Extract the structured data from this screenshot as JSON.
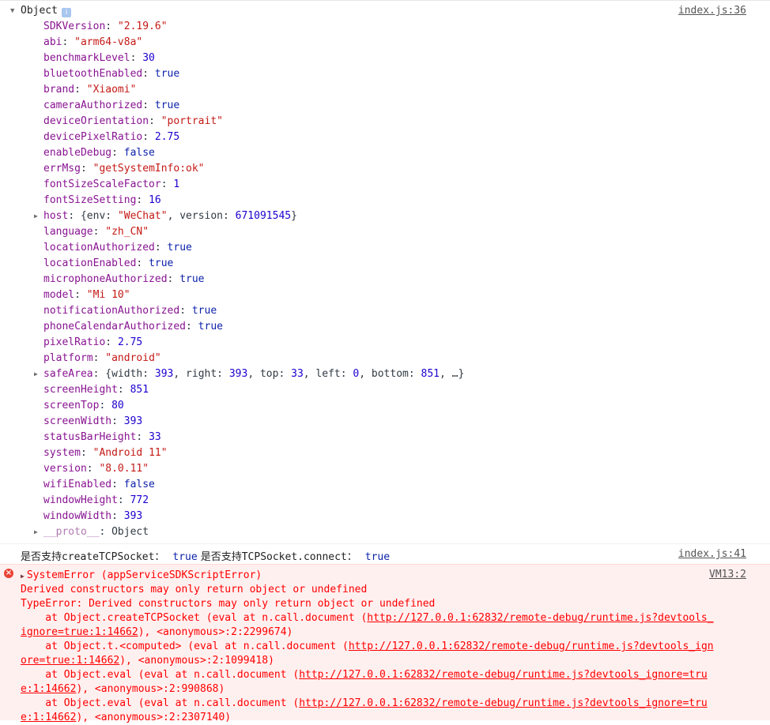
{
  "object_log": {
    "title": "Object",
    "info_icon": "i",
    "source": "index.js:36",
    "props": [
      {
        "key": "SDKVersion",
        "value": "\"2.19.6\"",
        "type": "s"
      },
      {
        "key": "abi",
        "value": "\"arm64-v8a\"",
        "type": "s"
      },
      {
        "key": "benchmarkLevel",
        "value": "30",
        "type": "n"
      },
      {
        "key": "bluetoothEnabled",
        "value": "true",
        "type": "b"
      },
      {
        "key": "brand",
        "value": "\"Xiaomi\"",
        "type": "s"
      },
      {
        "key": "cameraAuthorized",
        "value": "true",
        "type": "b"
      },
      {
        "key": "deviceOrientation",
        "value": "\"portrait\"",
        "type": "s"
      },
      {
        "key": "devicePixelRatio",
        "value": "2.75",
        "type": "n"
      },
      {
        "key": "enableDebug",
        "value": "false",
        "type": "b"
      },
      {
        "key": "errMsg",
        "value": "\"getSystemInfo:ok\"",
        "type": "s"
      },
      {
        "key": "fontSizeScaleFactor",
        "value": "1",
        "type": "n"
      },
      {
        "key": "fontSizeSetting",
        "value": "16",
        "type": "n"
      },
      {
        "key": "host",
        "expandable": true,
        "parts": [
          [
            "p",
            "{env: "
          ],
          [
            "s",
            "\"WeChat\""
          ],
          [
            "p",
            ", version: "
          ],
          [
            "n",
            "671091545"
          ],
          [
            "p",
            "}"
          ]
        ]
      },
      {
        "key": "language",
        "value": "\"zh_CN\"",
        "type": "s"
      },
      {
        "key": "locationAuthorized",
        "value": "true",
        "type": "b"
      },
      {
        "key": "locationEnabled",
        "value": "true",
        "type": "b"
      },
      {
        "key": "microphoneAuthorized",
        "value": "true",
        "type": "b"
      },
      {
        "key": "model",
        "value": "\"Mi 10\"",
        "type": "s"
      },
      {
        "key": "notificationAuthorized",
        "value": "true",
        "type": "b"
      },
      {
        "key": "phoneCalendarAuthorized",
        "value": "true",
        "type": "b"
      },
      {
        "key": "pixelRatio",
        "value": "2.75",
        "type": "n"
      },
      {
        "key": "platform",
        "value": "\"android\"",
        "type": "s"
      },
      {
        "key": "safeArea",
        "expandable": true,
        "parts": [
          [
            "p",
            "{width: "
          ],
          [
            "n",
            "393"
          ],
          [
            "p",
            ", right: "
          ],
          [
            "n",
            "393"
          ],
          [
            "p",
            ", top: "
          ],
          [
            "n",
            "33"
          ],
          [
            "p",
            ", left: "
          ],
          [
            "n",
            "0"
          ],
          [
            "p",
            ", bottom: "
          ],
          [
            "n",
            "851"
          ],
          [
            "p",
            ", …}"
          ]
        ]
      },
      {
        "key": "screenHeight",
        "value": "851",
        "type": "n"
      },
      {
        "key": "screenTop",
        "value": "80",
        "type": "n"
      },
      {
        "key": "screenWidth",
        "value": "393",
        "type": "n"
      },
      {
        "key": "statusBarHeight",
        "value": "33",
        "type": "n"
      },
      {
        "key": "system",
        "value": "\"Android 11\"",
        "type": "s"
      },
      {
        "key": "version",
        "value": "\"8.0.11\"",
        "type": "s"
      },
      {
        "key": "wifiEnabled",
        "value": "false",
        "type": "b"
      },
      {
        "key": "windowHeight",
        "value": "772",
        "type": "n"
      },
      {
        "key": "windowWidth",
        "value": "393",
        "type": "n"
      },
      {
        "key": "__proto__",
        "expandable": true,
        "proto": true,
        "parts": [
          [
            "p",
            "Object"
          ]
        ]
      }
    ]
  },
  "tcp_log": {
    "label1": "是否支持createTCPSocket：",
    "value1": "true",
    "label2": "是否支持TCPSocket.connect：",
    "value2": "true",
    "source": "index.js:41"
  },
  "error_log": {
    "icon": "×",
    "source": "VM13:2",
    "lines": [
      {
        "segments": [
          {
            "t": "SystemError (appServiceSDKScriptError)"
          }
        ],
        "indent": false,
        "caret": true
      },
      {
        "segments": [
          {
            "t": "Derived constructors may only return object or undefined"
          }
        ],
        "indent": false
      },
      {
        "segments": [
          {
            "t": "TypeError: Derived constructors may only return object or undefined"
          }
        ],
        "indent": false
      },
      {
        "segments": [
          {
            "t": "    at Object.createTCPSocket (eval at n.call.document ("
          },
          {
            "t": "http://127.0.0.1:62832/remote-debug/runtime.js?devtools_",
            "link": true
          }
        ],
        "indent": false
      },
      {
        "segments": [
          {
            "t": "ignore=true:1:14662",
            "link": true
          },
          {
            "t": "), <anonymous>:2:2299674)"
          }
        ],
        "indent": false
      },
      {
        "segments": [
          {
            "t": "    at Object.t.<computed> (eval at n.call.document ("
          },
          {
            "t": "http://127.0.0.1:62832/remote-debug/runtime.js?devtools_ign",
            "link": true
          }
        ],
        "indent": false
      },
      {
        "segments": [
          {
            "t": "ore=true:1:14662",
            "link": true
          },
          {
            "t": "), <anonymous>:2:1099418)"
          }
        ],
        "indent": false
      },
      {
        "segments": [
          {
            "t": "    at Object.eval (eval at n.call.document ("
          },
          {
            "t": "http://127.0.0.1:62832/remote-debug/runtime.js?devtools_ignore=tru",
            "link": true
          }
        ],
        "indent": false
      },
      {
        "segments": [
          {
            "t": "e:1:14662",
            "link": true
          },
          {
            "t": "), <anonymous>:2:990868)"
          }
        ],
        "indent": false
      },
      {
        "segments": [
          {
            "t": "    at Object.eval (eval at n.call.document ("
          },
          {
            "t": "http://127.0.0.1:62832/remote-debug/runtime.js?devtools_ignore=tru",
            "link": true
          }
        ],
        "indent": false
      },
      {
        "segments": [
          {
            "t": "e:1:14662",
            "link": true
          },
          {
            "t": "), <anonymous>:2:2307140)"
          }
        ],
        "indent": false
      }
    ]
  }
}
